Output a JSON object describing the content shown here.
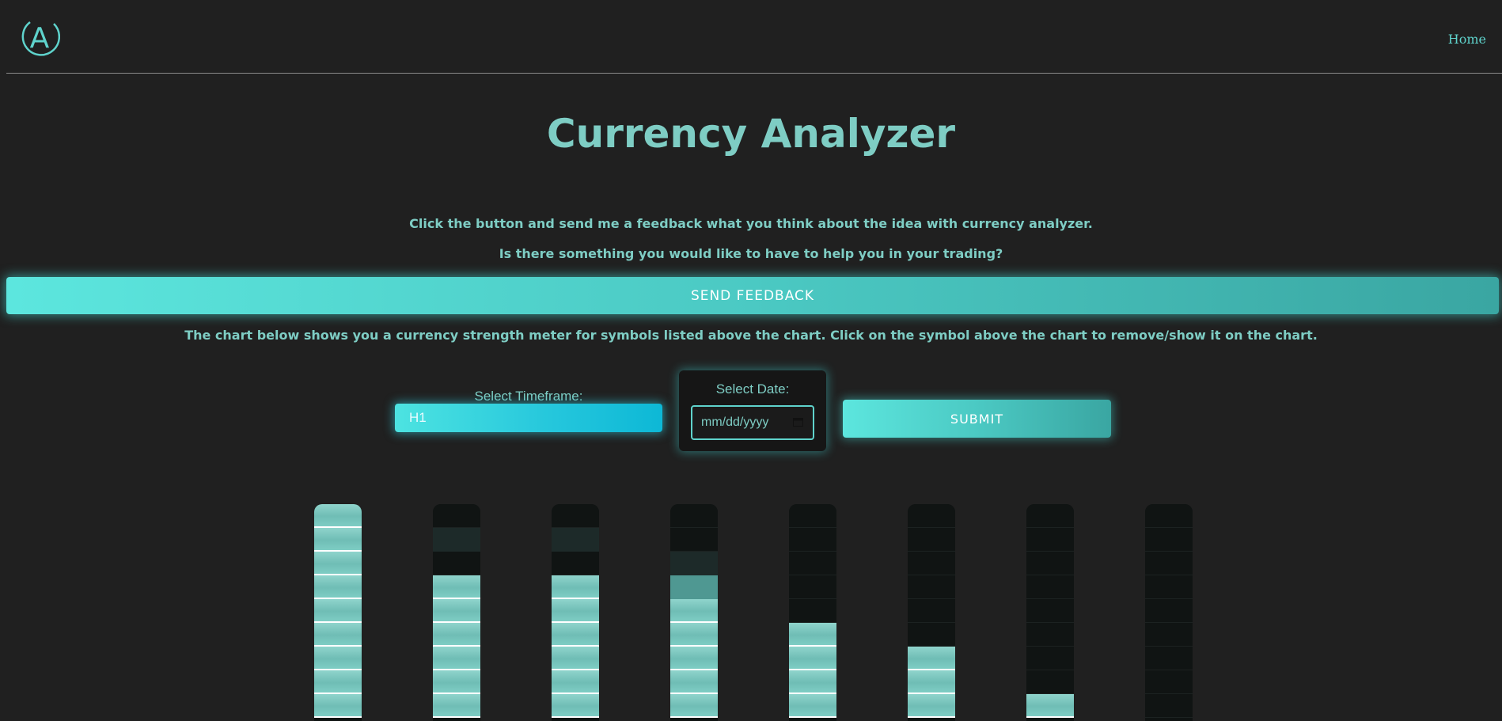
{
  "header": {
    "logo_letter": "A",
    "nav_home": "Home"
  },
  "main": {
    "title": "Currency Analyzer",
    "intro_line1": "Click the button and send me a feedback what you think about the idea with currency analyzer.",
    "intro_line2": "Is there something you would like to have to help you in your trading?",
    "feedback_button": "SEND FEEDBACK",
    "chart_description": "The chart below shows you a currency strength meter for symbols listed above the chart. Click on the symbol above the chart to remove/show it on the chart."
  },
  "controls": {
    "timeframe_label": "Select Timeframe:",
    "timeframe_value": "H1",
    "date_label": "Select Date:",
    "date_placeholder": "mm/dd/yyyy",
    "submit_button": "SUBMIT"
  },
  "colors": {
    "background": "#202020",
    "accent": "#7ecdc4",
    "accent_bright": "#5ce6de"
  },
  "chart_data": {
    "type": "bar",
    "segments_per_bar": 9,
    "values": [
      9,
      6,
      6,
      5,
      4,
      3,
      1,
      0
    ],
    "partials": [
      0,
      0,
      0,
      0.5,
      0,
      0,
      0,
      0
    ]
  }
}
